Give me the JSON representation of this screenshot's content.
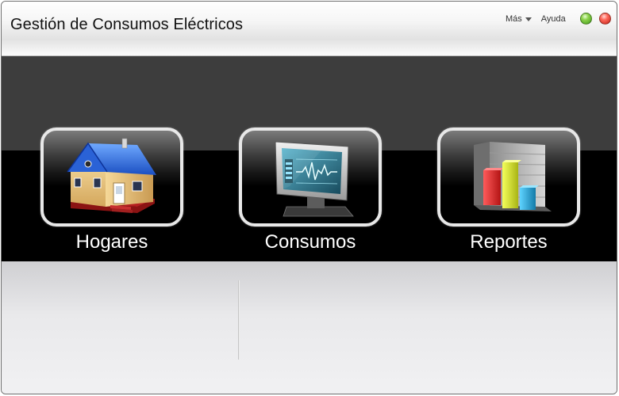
{
  "window": {
    "title": "Gestión de Consumos Eléctricos",
    "menu": {
      "more_label": "Más",
      "help_label": "Ayuda"
    },
    "controls": {
      "minimize_color": "#7cc240",
      "close_color": "#e53a2e"
    }
  },
  "tiles": [
    {
      "label": "Hogares",
      "icon": "house-icon"
    },
    {
      "label": "Consumos",
      "icon": "monitor-icon"
    },
    {
      "label": "Reportes",
      "icon": "bar-chart-icon"
    }
  ],
  "colors": {
    "band_dark": "#3d3d3d",
    "band_black": "#000000",
    "tile_border": "#e8e8e8",
    "lower_panel": "#e9e9eb"
  }
}
